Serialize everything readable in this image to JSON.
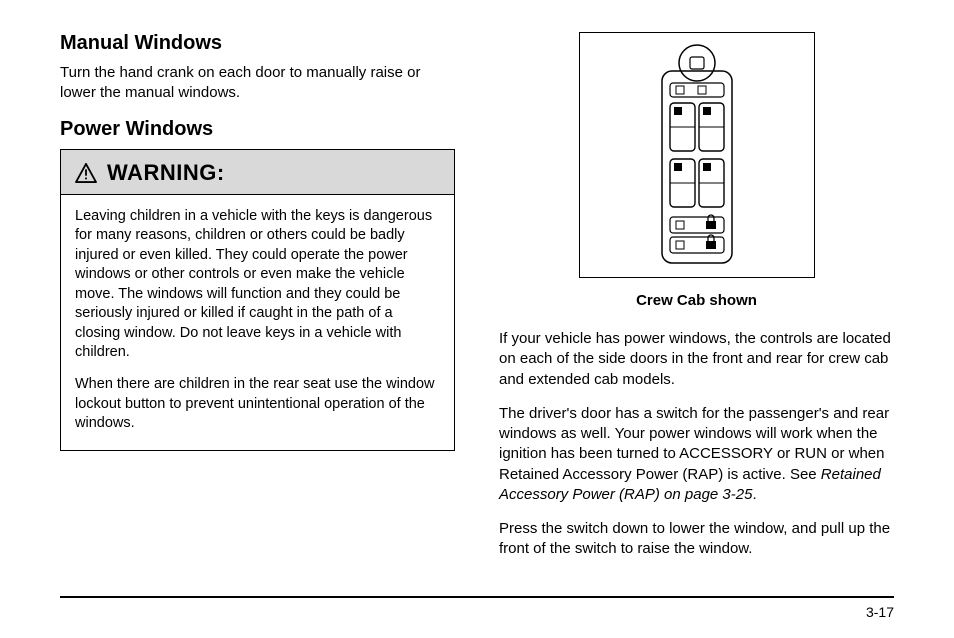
{
  "left": {
    "h_manual": "Manual Windows",
    "p_manual": "Turn the hand crank on each door to manually raise or lower the manual windows.",
    "h_power": "Power Windows",
    "warning_label": "WARNING:",
    "warn_p1": "Leaving children in a vehicle with the keys is dangerous for many reasons, children or others could be badly injured or even killed. They could operate the power windows or other controls or even make the vehicle move. The windows will function and they could be seriously injured or killed if caught in the path of a closing window. Do not leave keys in a vehicle with children.",
    "warn_p2": "When there are children in the rear seat use the window lockout button to prevent unintentional operation of the windows."
  },
  "right": {
    "caption": "Crew Cab shown",
    "p1": "If your vehicle has power windows, the controls are located on each of the side doors in the front and rear for crew cab and extended cab models.",
    "p2a": "The driver's door has a switch for the passenger's and rear windows as well. Your power windows will work when the ignition has been turned to ACCESSORY or RUN or when Retained Accessory Power (RAP) is active. See ",
    "p2_ref": "Retained Accessory Power (RAP) on page 3‑25",
    "p2b": ".",
    "p3": "Press the switch down to lower the window, and pull up the front of the switch to raise the window."
  },
  "page_number": "3-17"
}
